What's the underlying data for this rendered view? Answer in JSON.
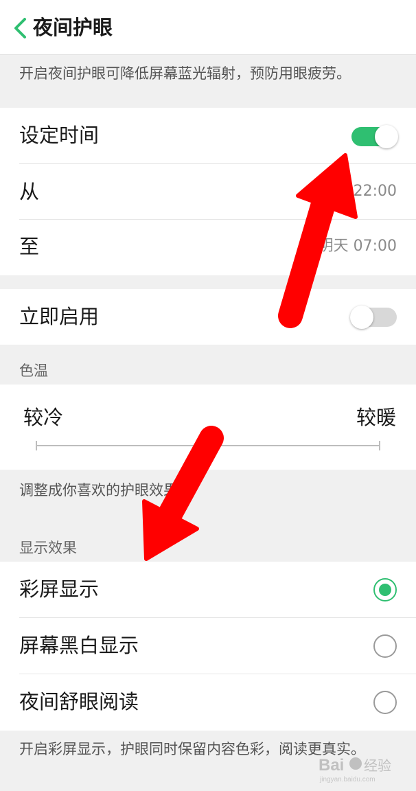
{
  "header": {
    "back_icon": "chevron-left-icon",
    "title": "夜间护眼"
  },
  "intro_hint": "开启夜间护眼可降低屏幕蓝光辐射，预防用眼疲劳。",
  "schedule": {
    "set_time_label": "设定时间",
    "set_time_enabled": true,
    "from_label": "从",
    "from_value": "22:00",
    "to_label": "至",
    "to_value": "明天 07:00"
  },
  "enable_now": {
    "label": "立即启用",
    "enabled": false
  },
  "color_temp": {
    "section_label": "色温",
    "cool_label": "较冷",
    "warm_label": "较暖",
    "level": 0.5,
    "hint": "调整成你喜欢的护眼效果。"
  },
  "display_effect": {
    "section_label": "显示效果",
    "options": [
      {
        "label": "彩屏显示",
        "selected": true
      },
      {
        "label": "屏幕黑白显示",
        "selected": false
      },
      {
        "label": "夜间舒眼阅读",
        "selected": false
      }
    ],
    "hint": "开启彩屏显示，护眼同时保留内容色彩，阅读更真实。"
  },
  "watermark": {
    "brand": "Baidu经验",
    "url": "jingyan.baidu.com"
  },
  "colors": {
    "accent": "#2fbf71",
    "annotation_arrow": "#ff0000"
  }
}
